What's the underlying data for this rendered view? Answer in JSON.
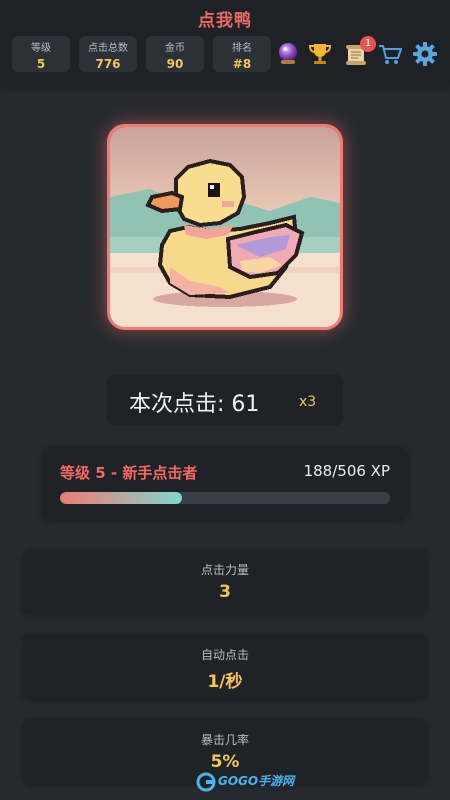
{
  "app": {
    "title": "点我鸭"
  },
  "stats": [
    {
      "label": "等级",
      "value": "5"
    },
    {
      "label": "点击总数",
      "value": "776"
    },
    {
      "label": "金币",
      "value": "90"
    },
    {
      "label": "排名",
      "value": "#8"
    }
  ],
  "toolbar": {
    "icons": [
      "crystal-ball-icon",
      "trophy-icon",
      "scroll-icon",
      "cart-icon",
      "gear-icon"
    ],
    "notification_count": "1"
  },
  "click_counter": {
    "label": "本次点击: 61",
    "multiplier": "x3"
  },
  "level": {
    "name": "等级 5 - 新手点击者",
    "xp": "188/506 XP",
    "progress": 0.371
  },
  "upgrades": [
    {
      "name": "点击力量",
      "value": "3"
    },
    {
      "name": "自动点击",
      "value": "1/秒"
    },
    {
      "name": "暴击几率",
      "value": "5%"
    }
  ],
  "watermark": {
    "text": "GOGO手游网"
  },
  "colors": {
    "accent_red": "#f06a62",
    "gold": "#f3c55b",
    "teal": "#7fd8cd",
    "background": "#262a30",
    "card": "#1f2328"
  }
}
